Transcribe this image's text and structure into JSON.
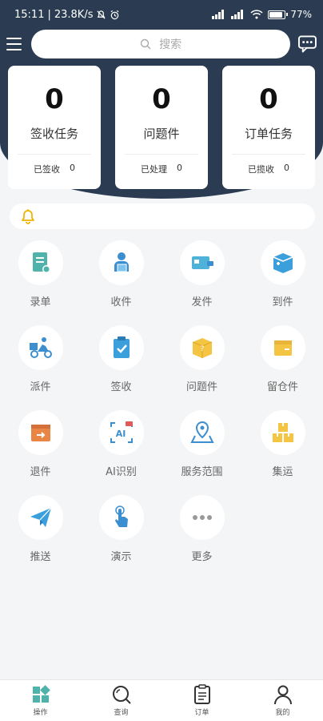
{
  "status": {
    "time": "15:11",
    "speed": "23.8K/s",
    "battery": "77",
    "battery_level": 0.77
  },
  "search": {
    "placeholder": "搜索"
  },
  "cards": [
    {
      "value": "0",
      "title": "签收任务",
      "sub_label": "已签收",
      "sub_value": "0"
    },
    {
      "value": "0",
      "title": "问题件",
      "sub_label": "已处理",
      "sub_value": "0"
    },
    {
      "value": "0",
      "title": "订单任务",
      "sub_label": "已揽收",
      "sub_value": "0"
    }
  ],
  "grid": [
    {
      "label": "录单",
      "icon": "document-icon"
    },
    {
      "label": "收件",
      "icon": "courier-receive-icon"
    },
    {
      "label": "发件",
      "icon": "send-package-icon"
    },
    {
      "label": "到件",
      "icon": "arrive-box-icon"
    },
    {
      "label": "派件",
      "icon": "delivery-scooter-icon"
    },
    {
      "label": "签收",
      "icon": "clipboard-check-icon"
    },
    {
      "label": "问题件",
      "icon": "question-box-icon"
    },
    {
      "label": "留仓件",
      "icon": "warehouse-box-icon"
    },
    {
      "label": "退件",
      "icon": "return-box-icon"
    },
    {
      "label": "AI识别",
      "icon": "ai-scan-icon"
    },
    {
      "label": "服务范围",
      "icon": "location-pin-icon"
    },
    {
      "label": "集运",
      "icon": "stacked-boxes-icon"
    },
    {
      "label": "推送",
      "icon": "paper-plane-icon"
    },
    {
      "label": "演示",
      "icon": "touch-hand-icon"
    },
    {
      "label": "更多",
      "icon": "more-dots-icon"
    }
  ],
  "tabs": [
    {
      "label": "操作",
      "icon": "grid-apps-icon",
      "active": true
    },
    {
      "label": "查询",
      "icon": "search-icon"
    },
    {
      "label": "订单",
      "icon": "order-list-icon"
    },
    {
      "label": "我的",
      "icon": "person-icon"
    }
  ],
  "colors": {
    "header": "#2b3c52",
    "accent": "#4fb3ac",
    "blue": "#3b8fd1",
    "yellow": "#f4c542",
    "orange": "#e98545"
  }
}
